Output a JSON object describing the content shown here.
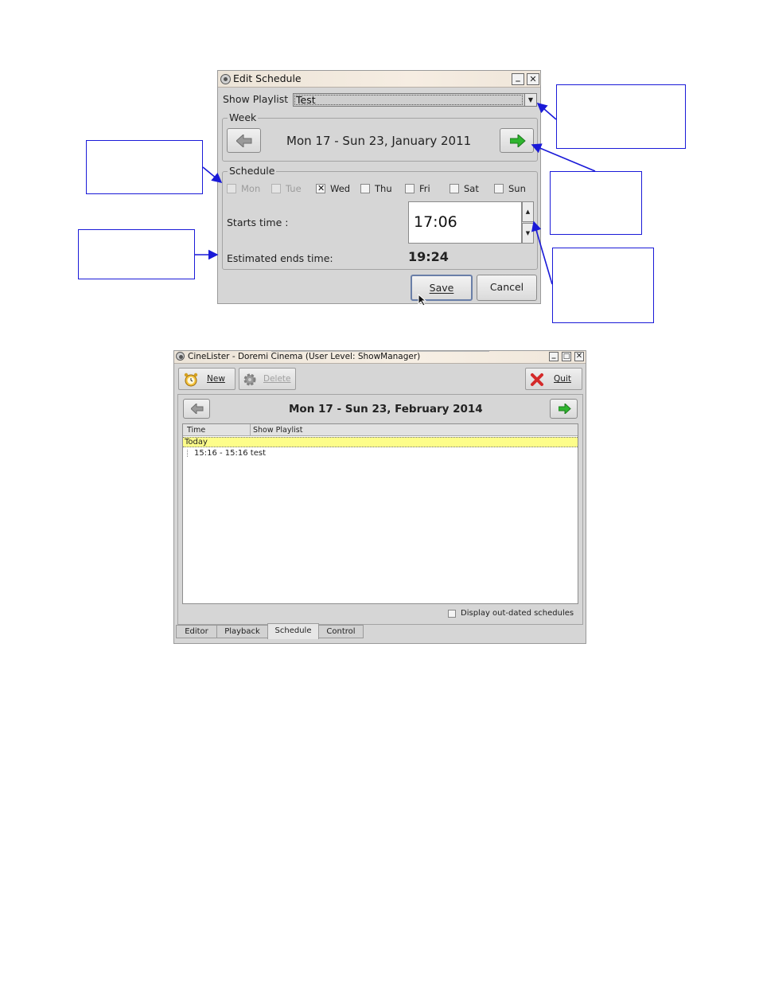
{
  "edit_dialog": {
    "title": "Edit Schedule",
    "show_playlist_label": "Show Playlist",
    "show_playlist_value": "Test",
    "week_group_label": "Week",
    "week_range": "Mon 17 - Sun 23, January 2011",
    "schedule_group_label": "Schedule",
    "days": [
      {
        "label": "Mon",
        "checked": false,
        "enabled": false
      },
      {
        "label": "Tue",
        "checked": false,
        "enabled": false
      },
      {
        "label": "Wed",
        "checked": true,
        "enabled": true
      },
      {
        "label": "Thu",
        "checked": false,
        "enabled": true
      },
      {
        "label": "Fri",
        "checked": false,
        "enabled": true
      },
      {
        "label": "Sat",
        "checked": false,
        "enabled": true
      },
      {
        "label": "Sun",
        "checked": false,
        "enabled": true
      }
    ],
    "starts_time_label": "Starts time :",
    "starts_time_value": "17:06",
    "estimated_end_label": "Estimated ends time:",
    "estimated_end_value": "19:24",
    "save_label": "Save",
    "cancel_label": "Cancel"
  },
  "cinelister": {
    "title": "CineLister - Doremi Cinema (User Level: ShowManager)",
    "toolbar": {
      "new_label": "New",
      "delete_label": "Delete",
      "quit_label": "Quit"
    },
    "week_range": "Mon 17 - Sun 23, February 2014",
    "columns": [
      "Time",
      "Show Playlist"
    ],
    "today_label": "Today",
    "schedule_rows": [
      {
        "text": "15:16 - 15:16 test"
      }
    ],
    "display_outdated_label": "Display out-dated schedules",
    "tabs": [
      {
        "label": "Editor",
        "active": false
      },
      {
        "label": "Playback",
        "active": false
      },
      {
        "label": "Schedule",
        "active": true
      },
      {
        "label": "Control",
        "active": false
      }
    ]
  },
  "colors": {
    "annotation": "#1a1ad8",
    "today_highlight": "#fdfd8a",
    "arrow_green": "#2fb52f",
    "quit_red": "#d42a2a"
  },
  "icons": {
    "nav_prev": "arrow-left-icon",
    "nav_next": "arrow-right-green-icon",
    "new": "alarm-clock-icon",
    "delete": "gear-icon",
    "quit": "red-x-icon"
  }
}
